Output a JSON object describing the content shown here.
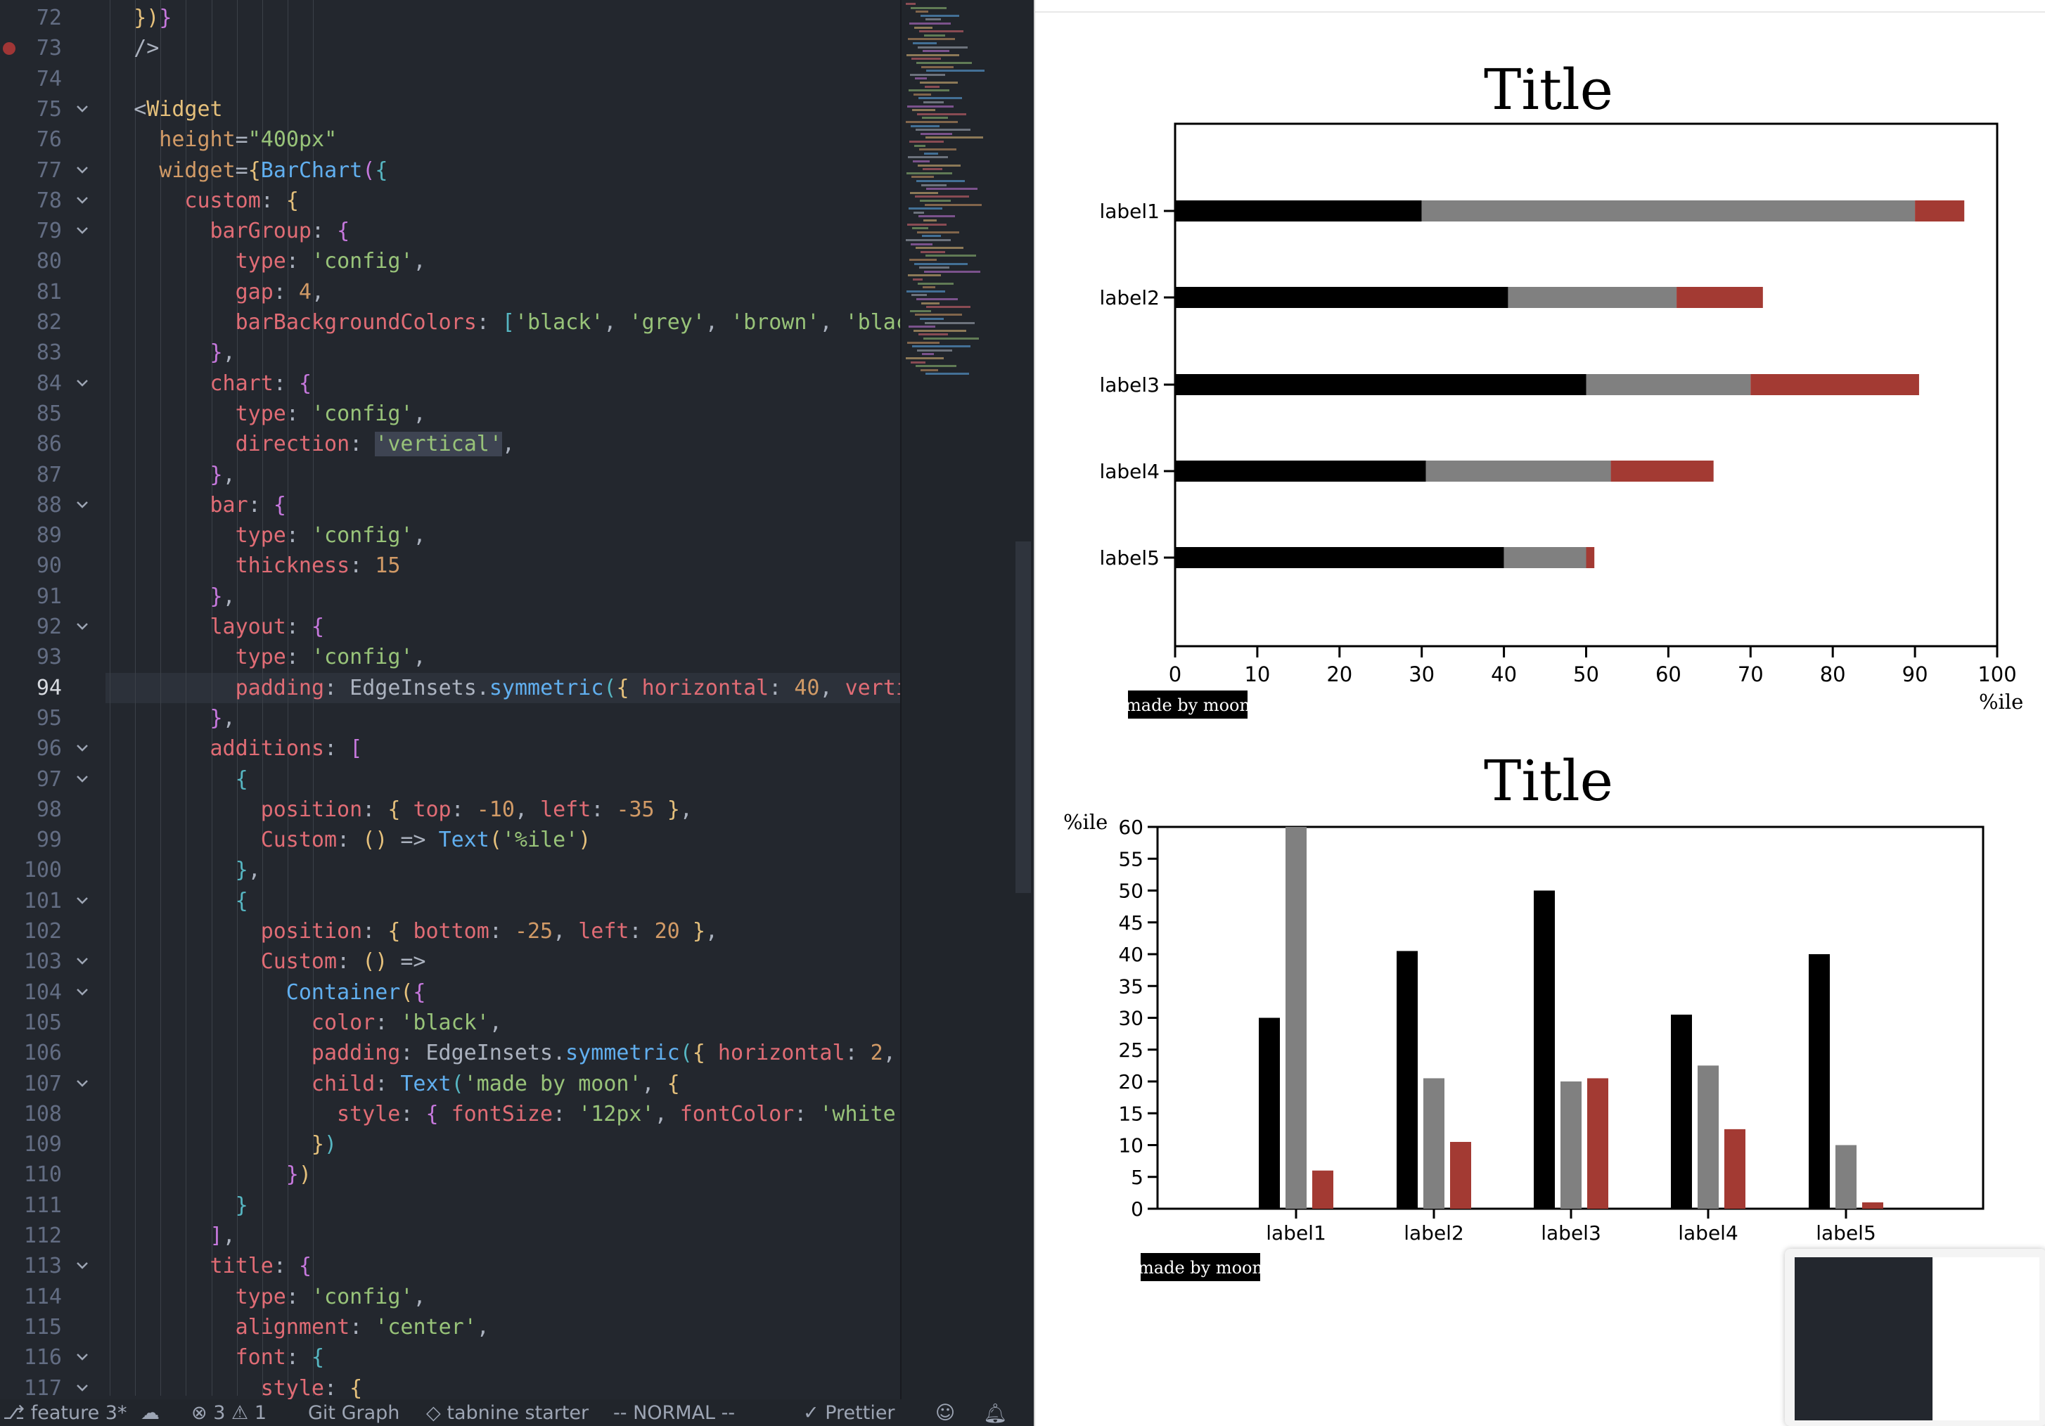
{
  "editor": {
    "line_numbers": [
      "72",
      "73",
      "74",
      "75",
      "76",
      "77",
      "78",
      "79",
      "80",
      "81",
      "82",
      "83",
      "84",
      "85",
      "86",
      "87",
      "88",
      "89",
      "90",
      "91",
      "92",
      "93",
      "94",
      "95",
      "96",
      "97",
      "98",
      "99",
      "100",
      "101",
      "102",
      "103",
      "104",
      "105",
      "106",
      "107",
      "108",
      "109",
      "110",
      "111",
      "112",
      "113",
      "114",
      "115",
      "116",
      "117"
    ],
    "active_line": "94",
    "lines": [
      [
        [
          "t-br1",
          "})"
        ],
        [
          "t-br2",
          "}"
        ]
      ],
      [
        [
          "t-pun",
          "/>"
        ]
      ],
      [],
      [
        [
          "t-pun",
          "<"
        ],
        [
          "t-comp",
          "Widget"
        ]
      ],
      [
        [
          "t-attr",
          "height"
        ],
        [
          "t-pun",
          "="
        ],
        [
          "t-str",
          "\"400px\""
        ]
      ],
      [
        [
          "t-attr",
          "widget"
        ],
        [
          "t-pun",
          "="
        ],
        [
          "t-br1",
          "{"
        ],
        [
          "t-fn",
          "BarChart"
        ],
        [
          "t-br2",
          "("
        ],
        [
          "t-br3",
          "{"
        ]
      ],
      [
        [
          "t-key",
          "custom"
        ],
        [
          "t-pun",
          ": "
        ],
        [
          "t-br1",
          "{"
        ]
      ],
      [
        [
          "t-key",
          "barGroup"
        ],
        [
          "t-pun",
          ": "
        ],
        [
          "t-br2",
          "{"
        ]
      ],
      [
        [
          "t-key",
          "type"
        ],
        [
          "t-pun",
          ": "
        ],
        [
          "t-str",
          "'config'"
        ],
        [
          "t-pun",
          ","
        ]
      ],
      [
        [
          "t-key",
          "gap"
        ],
        [
          "t-pun",
          ": "
        ],
        [
          "t-num",
          "4"
        ],
        [
          "t-pun",
          ","
        ]
      ],
      [
        [
          "t-key",
          "barBackgroundColors"
        ],
        [
          "t-pun",
          ": "
        ],
        [
          "t-br3",
          "["
        ],
        [
          "t-str",
          "'black'"
        ],
        [
          "t-pun",
          ", "
        ],
        [
          "t-str",
          "'grey'"
        ],
        [
          "t-pun",
          ", "
        ],
        [
          "t-str",
          "'brown'"
        ],
        [
          "t-pun",
          ", "
        ],
        [
          "t-str",
          "'black"
        ]
      ],
      [
        [
          "t-br2",
          "}"
        ],
        [
          "t-pun",
          ","
        ]
      ],
      [
        [
          "t-key",
          "chart"
        ],
        [
          "t-pun",
          ": "
        ],
        [
          "t-br2",
          "{"
        ]
      ],
      [
        [
          "t-key",
          "type"
        ],
        [
          "t-pun",
          ": "
        ],
        [
          "t-str",
          "'config'"
        ],
        [
          "t-pun",
          ","
        ]
      ],
      [
        [
          "t-key",
          "direction"
        ],
        [
          "t-pun",
          ": "
        ],
        [
          "t-str",
          "'vertical'"
        ],
        [
          "t-pun",
          ","
        ]
      ],
      [
        [
          "t-br2",
          "}"
        ],
        [
          "t-pun",
          ","
        ]
      ],
      [
        [
          "t-key",
          "bar"
        ],
        [
          "t-pun",
          ": "
        ],
        [
          "t-br2",
          "{"
        ]
      ],
      [
        [
          "t-key",
          "type"
        ],
        [
          "t-pun",
          ": "
        ],
        [
          "t-str",
          "'config'"
        ],
        [
          "t-pun",
          ","
        ]
      ],
      [
        [
          "t-key",
          "thickness"
        ],
        [
          "t-pun",
          ": "
        ],
        [
          "t-num",
          "15"
        ]
      ],
      [
        [
          "t-br2",
          "}"
        ],
        [
          "t-pun",
          ","
        ]
      ],
      [
        [
          "t-key",
          "layout"
        ],
        [
          "t-pun",
          ": "
        ],
        [
          "t-br2",
          "{"
        ]
      ],
      [
        [
          "t-key",
          "type"
        ],
        [
          "t-pun",
          ": "
        ],
        [
          "t-str",
          "'config'"
        ],
        [
          "t-pun",
          ","
        ]
      ],
      [
        [
          "t-key",
          "padding"
        ],
        [
          "t-pun",
          ": EdgeInsets."
        ],
        [
          "t-fn",
          "symmetric"
        ],
        [
          "t-br3",
          "("
        ],
        [
          "t-br1",
          "{"
        ],
        [
          "t-pun",
          " "
        ],
        [
          "t-key",
          "horizontal"
        ],
        [
          "t-pun",
          ": "
        ],
        [
          "t-num",
          "40"
        ],
        [
          "t-pun",
          ", "
        ],
        [
          "t-key",
          "verti"
        ]
      ],
      [
        [
          "t-br2",
          "}"
        ],
        [
          "t-pun",
          ","
        ]
      ],
      [
        [
          "t-key",
          "additions"
        ],
        [
          "t-pun",
          ": "
        ],
        [
          "t-br2",
          "["
        ]
      ],
      [
        [
          "t-br3",
          "{"
        ]
      ],
      [
        [
          "t-key",
          "position"
        ],
        [
          "t-pun",
          ": "
        ],
        [
          "t-br1",
          "{"
        ],
        [
          "t-pun",
          " "
        ],
        [
          "t-key",
          "top"
        ],
        [
          "t-pun",
          ": "
        ],
        [
          "t-num",
          "-10"
        ],
        [
          "t-pun",
          ", "
        ],
        [
          "t-key",
          "left"
        ],
        [
          "t-pun",
          ": "
        ],
        [
          "t-num",
          "-35"
        ],
        [
          "t-pun",
          " "
        ],
        [
          "t-br1",
          "}"
        ],
        [
          "t-pun",
          ","
        ]
      ],
      [
        [
          "t-key",
          "Custom"
        ],
        [
          "t-pun",
          ": "
        ],
        [
          "t-br1",
          "()"
        ],
        [
          "t-pun",
          " => "
        ],
        [
          "t-fn",
          "Text"
        ],
        [
          "t-br1",
          "("
        ],
        [
          "t-str",
          "'%ile'"
        ],
        [
          "t-br1",
          ")"
        ]
      ],
      [
        [
          "t-br3",
          "}"
        ],
        [
          "t-pun",
          ","
        ]
      ],
      [
        [
          "t-br3",
          "{"
        ]
      ],
      [
        [
          "t-key",
          "position"
        ],
        [
          "t-pun",
          ": "
        ],
        [
          "t-br1",
          "{"
        ],
        [
          "t-pun",
          " "
        ],
        [
          "t-key",
          "bottom"
        ],
        [
          "t-pun",
          ": "
        ],
        [
          "t-num",
          "-25"
        ],
        [
          "t-pun",
          ", "
        ],
        [
          "t-key",
          "left"
        ],
        [
          "t-pun",
          ": "
        ],
        [
          "t-num",
          "20"
        ],
        [
          "t-pun",
          " "
        ],
        [
          "t-br1",
          "}"
        ],
        [
          "t-pun",
          ","
        ]
      ],
      [
        [
          "t-key",
          "Custom"
        ],
        [
          "t-pun",
          ": "
        ],
        [
          "t-br1",
          "()"
        ],
        [
          "t-pun",
          " =>"
        ]
      ],
      [
        [
          "t-fn",
          "Container"
        ],
        [
          "t-br1",
          "("
        ],
        [
          "t-br2",
          "{"
        ]
      ],
      [
        [
          "t-key",
          "color"
        ],
        [
          "t-pun",
          ": "
        ],
        [
          "t-str",
          "'black'"
        ],
        [
          "t-pun",
          ","
        ]
      ],
      [
        [
          "t-key",
          "padding"
        ],
        [
          "t-pun",
          ": EdgeInsets."
        ],
        [
          "t-fn",
          "symmetric"
        ],
        [
          "t-br3",
          "("
        ],
        [
          "t-br1",
          "{"
        ],
        [
          "t-pun",
          " "
        ],
        [
          "t-key",
          "horizontal"
        ],
        [
          "t-pun",
          ": "
        ],
        [
          "t-num",
          "2"
        ],
        [
          "t-pun",
          ", "
        ]
      ],
      [
        [
          "t-key",
          "child"
        ],
        [
          "t-pun",
          ": "
        ],
        [
          "t-fn",
          "Text"
        ],
        [
          "t-br3",
          "("
        ],
        [
          "t-str",
          "'made by moon'"
        ],
        [
          "t-pun",
          ", "
        ],
        [
          "t-br1",
          "{"
        ]
      ],
      [
        [
          "t-key",
          "style"
        ],
        [
          "t-pun",
          ": "
        ],
        [
          "t-br2",
          "{"
        ],
        [
          "t-pun",
          " "
        ],
        [
          "t-key",
          "fontSize"
        ],
        [
          "t-pun",
          ": "
        ],
        [
          "t-str",
          "'12px'"
        ],
        [
          "t-pun",
          ", "
        ],
        [
          "t-key",
          "fontColor"
        ],
        [
          "t-pun",
          ": "
        ],
        [
          "t-str",
          "'white'"
        ]
      ],
      [
        [
          "t-br1",
          "}"
        ],
        [
          "t-br3",
          ")"
        ]
      ],
      [
        [
          "t-br2",
          "}"
        ],
        [
          "t-br1",
          ")"
        ]
      ],
      [
        [
          "t-br3",
          "}"
        ]
      ],
      [
        [
          "t-br2",
          "]"
        ],
        [
          "t-pun",
          ","
        ]
      ],
      [
        [
          "t-key",
          "title"
        ],
        [
          "t-pun",
          ": "
        ],
        [
          "t-br2",
          "{"
        ]
      ],
      [
        [
          "t-key",
          "type"
        ],
        [
          "t-pun",
          ": "
        ],
        [
          "t-str",
          "'config'"
        ],
        [
          "t-pun",
          ","
        ]
      ],
      [
        [
          "t-key",
          "alignment"
        ],
        [
          "t-pun",
          ": "
        ],
        [
          "t-str",
          "'center'"
        ],
        [
          "t-pun",
          ","
        ]
      ],
      [
        [
          "t-key",
          "font"
        ],
        [
          "t-pun",
          ": "
        ],
        [
          "t-br3",
          "{"
        ]
      ],
      [
        [
          "t-key",
          "style"
        ],
        [
          "t-pun",
          ": "
        ],
        [
          "t-br1",
          "{"
        ]
      ]
    ]
  },
  "statusbar": {
    "branch": "feature",
    "branch_state": "3*",
    "problems": "3",
    "warnings": "1",
    "git_graph": "Git Graph",
    "tabnine": "tabnine starter",
    "mode": "-- NORMAL --",
    "prettier": "Prettier"
  },
  "preview": {
    "chart1": {
      "title": "Title",
      "unit": "%ile",
      "badge": "made by moon"
    },
    "chart2": {
      "title": "Title",
      "unit": "%ile",
      "badge": "made by moon"
    }
  },
  "colors": {
    "black": "#000000",
    "grey": "#808080",
    "brown": "#a33a33"
  },
  "chart_data": [
    {
      "type": "bar",
      "orientation": "horizontal",
      "stacked": true,
      "title": "Title",
      "xlabel": "%ile",
      "categories": [
        "label1",
        "label2",
        "label3",
        "label4",
        "label5"
      ],
      "series": [
        {
          "color": "black",
          "values": [
            30,
            40.5,
            50,
            30.5,
            40
          ]
        },
        {
          "color": "grey",
          "values": [
            60,
            20.5,
            20,
            22.5,
            10
          ]
        },
        {
          "color": "brown",
          "values": [
            6,
            10.5,
            20.5,
            12.5,
            1
          ]
        }
      ],
      "xlim": [
        0,
        100
      ],
      "xticks": [
        "0",
        "10",
        "20",
        "30",
        "40",
        "50",
        "60",
        "70",
        "80",
        "90",
        "100"
      ]
    },
    {
      "type": "bar",
      "orientation": "vertical",
      "stacked": false,
      "title": "Title",
      "ylabel": "%ile",
      "categories": [
        "label1",
        "label2",
        "label3",
        "label4",
        "label5"
      ],
      "series": [
        {
          "color": "black",
          "values": [
            30,
            40.5,
            50,
            30.5,
            40
          ]
        },
        {
          "color": "grey",
          "values": [
            60,
            20.5,
            20,
            22.5,
            10
          ]
        },
        {
          "color": "brown",
          "values": [
            6,
            10.5,
            20.5,
            12.5,
            1
          ]
        }
      ],
      "ylim": [
        0,
        60
      ],
      "yticks": [
        "0",
        "5",
        "10",
        "15",
        "20",
        "25",
        "30",
        "35",
        "40",
        "45",
        "50",
        "55",
        "60"
      ]
    }
  ]
}
